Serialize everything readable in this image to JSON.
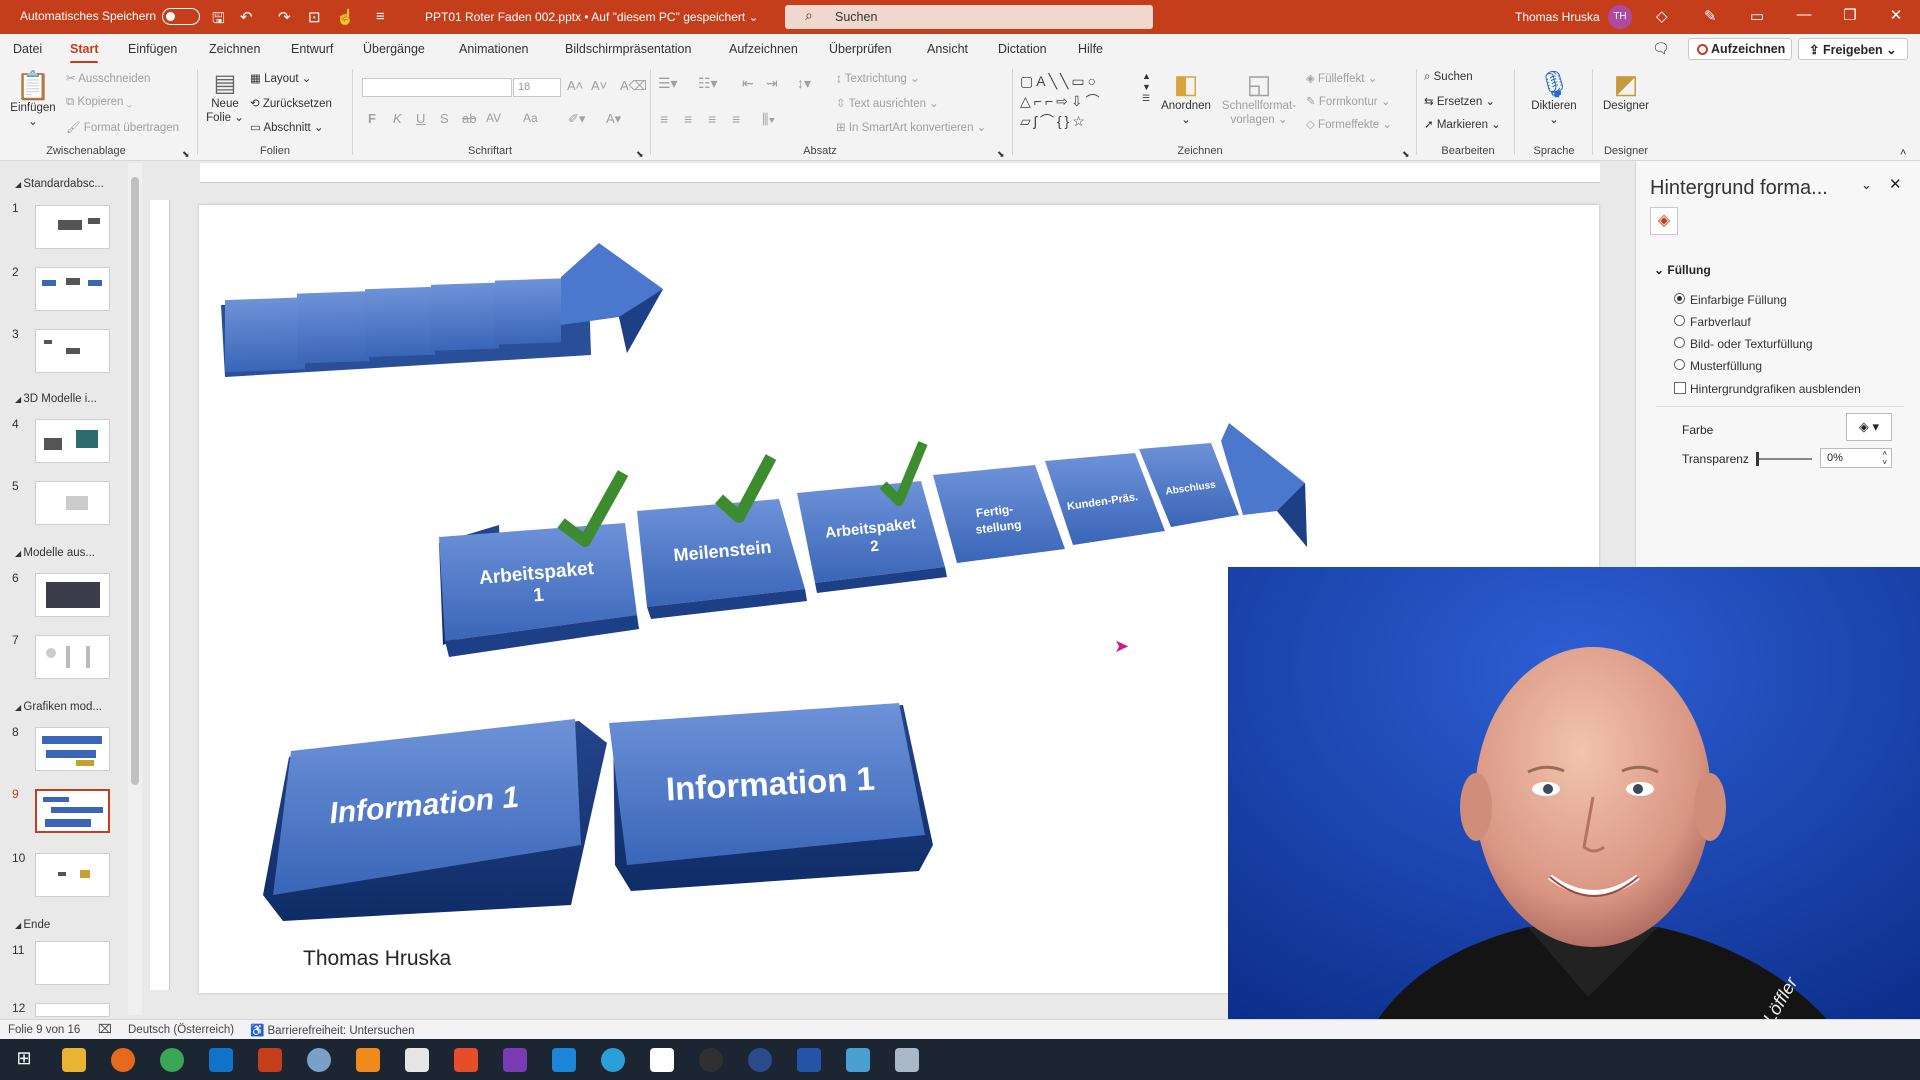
{
  "titlebar": {
    "autosave_label": "Automatisches Speichern",
    "document_title": "PPT01 Roter Faden 002.pptx • Auf \"diesem PC\" gespeichert ⌄",
    "search_placeholder": "Suchen",
    "user_name": "Thomas Hruska",
    "user_initials": "TH"
  },
  "menu": {
    "tabs": [
      "Datei",
      "Start",
      "Einfügen",
      "Zeichnen",
      "Entwurf",
      "Übergänge",
      "Animationen",
      "Bildschirmpräsentation",
      "Aufzeichnen",
      "Überprüfen",
      "Ansicht",
      "Dictation",
      "Hilfe"
    ],
    "record_label": "Aufzeichnen",
    "share_label": "Freigeben"
  },
  "ribbon": {
    "clipboard": {
      "paste": "Einfügen",
      "cut": "Ausschneiden",
      "copy": "Kopieren",
      "format_painter": "Format übertragen",
      "group": "Zwischenablage"
    },
    "slides": {
      "new_slide_line1": "Neue",
      "new_slide_line2": "Folie",
      "layout": "Layout",
      "reset": "Zurücksetzen",
      "section": "Abschnitt",
      "group": "Folien"
    },
    "font": {
      "size": "18",
      "bold": "F",
      "italic": "K",
      "underline": "U",
      "strike": "S",
      "spacing": "AV",
      "case": "Aa",
      "group": "Schriftart"
    },
    "paragraph": {
      "direction": "Textrichtung",
      "align": "Text ausrichten",
      "smartart": "In SmartArt konvertieren",
      "group": "Absatz"
    },
    "drawing": {
      "arrange": "Anordnen",
      "quickstyles_line1": "Schnellformat-",
      "quickstyles_line2": "vorlagen",
      "fill": "Fülleffekt",
      "outline": "Formkontur",
      "effects": "Formeffekte",
      "group": "Zeichnen"
    },
    "editing": {
      "find": "Suchen",
      "replace": "Ersetzen",
      "select": "Markieren",
      "group": "Bearbeiten"
    },
    "voice": {
      "dictate": "Diktieren",
      "group": "Sprache"
    },
    "designer": {
      "label": "Designer",
      "group": "Designer"
    }
  },
  "thumbnails": {
    "sections": [
      "Standardabsc...",
      "3D Modelle i...",
      "Modelle aus...",
      "Grafiken mod...",
      "Ende"
    ],
    "numbers": [
      "1",
      "2",
      "3",
      "4",
      "5",
      "6",
      "7",
      "8",
      "9",
      "10",
      "11",
      "12"
    ]
  },
  "slide": {
    "steps": [
      "Arbeitspaket",
      "1",
      "Meilenstein",
      "Arbeitspaket",
      "2",
      "Fertig-",
      "stellung",
      "Kunden-Präs.",
      "Abschluss"
    ],
    "info_left": "Information 1",
    "info_right": "Information 1",
    "author": "Thomas Hruska"
  },
  "panel": {
    "title": "Hintergrund forma...",
    "section": "Füllung",
    "options": [
      "Einfarbige Füllung",
      "Farbverlauf",
      "Bild- oder Texturfüllung",
      "Musterfüllung"
    ],
    "checkbox": "Hintergrundgrafiken ausblenden",
    "color_label": "Farbe",
    "transparency_label": "Transparenz",
    "transparency_value": "0%"
  },
  "status": {
    "slide_info": "Folie 9 von 16",
    "language": "Deutsch (Österreich)",
    "accessibility": "Barrierefreiheit: Untersuchen"
  },
  "colors": {
    "accent": "#c43e1c",
    "shape_blue": "#3a66b8",
    "check_green": "#3d8c2f"
  }
}
